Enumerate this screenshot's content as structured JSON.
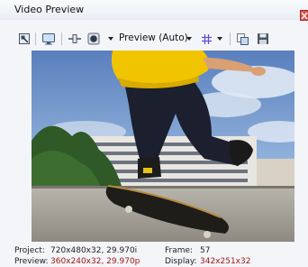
{
  "window": {
    "title": "Video Preview"
  },
  "toolbar": {
    "preview_mode": "Preview (Auto)",
    "icons": [
      "video-properties-icon",
      "external-monitor-icon",
      "split-screen-icon",
      "preview-quality-icon",
      "grid-icon",
      "copy-snapshot-icon",
      "save-snapshot-icon"
    ]
  },
  "status": {
    "project_label": "Project:",
    "project_value": "720x480x32, 29.970i",
    "preview_label": "Preview:",
    "preview_value": "360x240x32, 29.970p",
    "frame_label": "Frame:",
    "frame_value": "57",
    "display_label": "Display:",
    "display_value": "342x251x32"
  },
  "colors": {
    "accent_red": "#a01818",
    "window_bg": "#f4f5f8"
  }
}
